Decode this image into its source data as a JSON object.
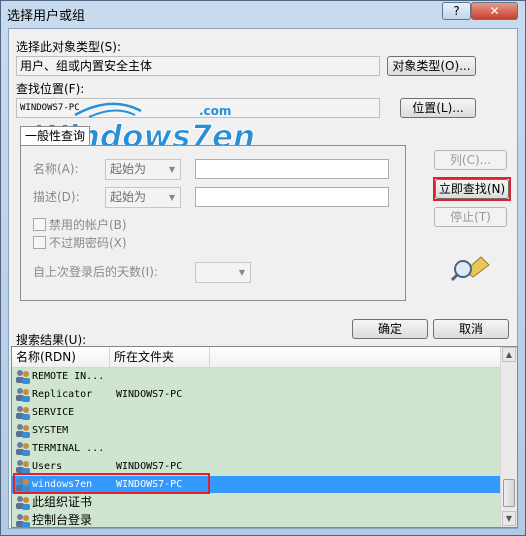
{
  "window": {
    "title": "选择用户或组",
    "help_label": "?",
    "close_label": "✕"
  },
  "object_type": {
    "label": "选择此对象类型(S):",
    "value": "用户、组或内置安全主体",
    "button": "对象类型(O)..."
  },
  "location": {
    "label": "查找位置(F):",
    "value": "WINDOWS7-PC",
    "button": "位置(L)..."
  },
  "watermark": {
    "text": "Windows7en",
    "suffix": ".com"
  },
  "query": {
    "tab_label": "一般性查询",
    "name_label": "名称(A):",
    "name_mode": "起始为",
    "desc_label": "描述(D):",
    "desc_mode": "起始为",
    "disabled_label": "禁用的帐户(B)",
    "noexpire_label": "不过期密码(X)",
    "lastlogon_label": "自上次登录后的天数(I):"
  },
  "side_buttons": {
    "columns": "列(C)...",
    "find_now": "立即查找(N)",
    "stop": "停止(T)"
  },
  "ok_label": "确定",
  "cancel_label": "取消",
  "results": {
    "label": "搜索结果(U):",
    "col_name": "名称(RDN)",
    "col_folder": "所在文件夹",
    "rows": [
      {
        "name": "REMOTE IN...",
        "folder": ""
      },
      {
        "name": "Replicator",
        "folder": "WINDOWS7-PC"
      },
      {
        "name": "SERVICE",
        "folder": ""
      },
      {
        "name": "SYSTEM",
        "folder": ""
      },
      {
        "name": "TERMINAL ...",
        "folder": ""
      },
      {
        "name": "Users",
        "folder": "WINDOWS7-PC"
      },
      {
        "name": "windows7en",
        "folder": "WINDOWS7-PC"
      },
      {
        "name": "此组织证书",
        "folder": ""
      },
      {
        "name": "控制台登录",
        "folder": ""
      }
    ]
  },
  "colors": {
    "highlight_red": "#e0202a",
    "selection": "#3399ff",
    "result_bg": "#cfe5cf",
    "logo_blue": "#2a8fd6"
  }
}
